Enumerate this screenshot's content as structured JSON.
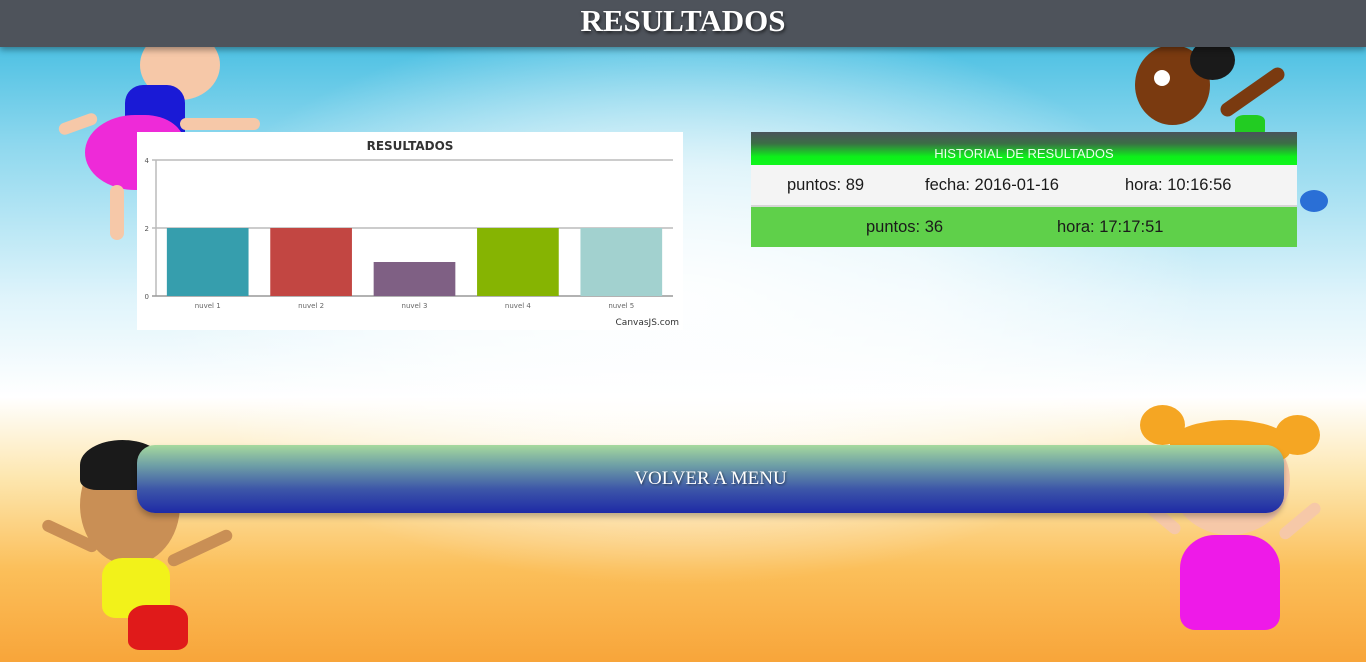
{
  "header": {
    "title": "RESULTADOS"
  },
  "chart_data": {
    "type": "bar",
    "title": "RESULTADOS",
    "categories": [
      "nuvel 1",
      "nuvel 2",
      "nuvel 3",
      "nuvel 4",
      "nuvel 5"
    ],
    "values": [
      2,
      2,
      1,
      2,
      2
    ],
    "colors": [
      "#369ead",
      "#c24642",
      "#7f6084",
      "#86b402",
      "#a2d1cf"
    ],
    "ylim": [
      0,
      4
    ],
    "yticks": [
      "0",
      "2",
      "4"
    ],
    "xlabel": "",
    "ylabel": "",
    "grid": true,
    "credit": "CanvasJS.com"
  },
  "history": {
    "title": "HISTORIAL DE RESULTADOS",
    "rows": [
      {
        "puntos": "puntos: 89",
        "fecha": "fecha: 2016-01-16",
        "hora": "hora: 10:16:56"
      },
      {
        "puntos": "puntos: 36",
        "hora": "hora: 17:17:51"
      }
    ]
  },
  "actions": {
    "back_label": "VOLVER A MENU"
  },
  "colors": {
    "header_bg": "#4e535b",
    "row_green": "#5fd04a",
    "button_blue": "#1e2aa6"
  }
}
